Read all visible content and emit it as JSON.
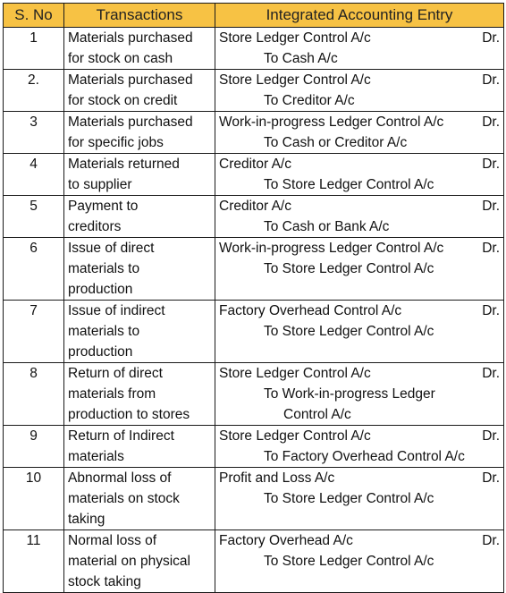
{
  "headers": {
    "sno": "S. No",
    "transactions": "Transactions",
    "entry": "Integrated Accounting Entry"
  },
  "rows": [
    {
      "sno": "1",
      "transaction": [
        "Materials purchased",
        "for stock on cash"
      ],
      "debit": "Store Ledger Control A/c",
      "dr": "Dr.",
      "credit": [
        "To Cash A/c"
      ]
    },
    {
      "sno": "2.",
      "transaction": [
        "Materials purchased",
        "for stock on credit"
      ],
      "debit": "Store Ledger Control A/c",
      "dr": "Dr.",
      "credit": [
        "To Creditor A/c"
      ]
    },
    {
      "sno": "3",
      "transaction": [
        "Materials purchased",
        "for specific jobs"
      ],
      "debit": "Work-in-progress Ledger Control A/c",
      "dr": "Dr.",
      "credit": [
        "To Cash or Creditor A/c"
      ]
    },
    {
      "sno": "4",
      "transaction": [
        "Materials returned",
        "to supplier"
      ],
      "debit": "Creditor A/c",
      "dr": "Dr.",
      "credit": [
        "To Store Ledger Control A/c"
      ]
    },
    {
      "sno": "5",
      "transaction": [
        "Payment to",
        "creditors"
      ],
      "debit": "Creditor A/c",
      "dr": "Dr.",
      "credit": [
        "To Cash or Bank A/c"
      ]
    },
    {
      "sno": "6",
      "transaction": [
        "Issue of direct",
        "materials to",
        "production"
      ],
      "debit": "Work-in-progress Ledger Control A/c",
      "dr": "Dr.",
      "credit": [
        "To Store Ledger Control A/c"
      ]
    },
    {
      "sno": "7",
      "transaction": [
        "Issue of indirect",
        "materials to",
        "production"
      ],
      "debit": "Factory Overhead Control A/c",
      "dr": "Dr.",
      "credit": [
        "To Store Ledger Control A/c"
      ]
    },
    {
      "sno": "8",
      "transaction": [
        "Return of direct",
        "materials from",
        "production to stores"
      ],
      "debit": "Store Ledger Control A/c",
      "dr": "Dr.",
      "credit": [
        "To Work-in-progress Ledger",
        "Control A/c"
      ]
    },
    {
      "sno": "9",
      "transaction": [
        "Return of Indirect",
        "materials"
      ],
      "debit": "Store Ledger Control A/c",
      "dr": "Dr.",
      "credit": [
        "To Factory Overhead Control A/c"
      ]
    },
    {
      "sno": "10",
      "transaction": [
        "Abnormal loss of",
        "materials on stock",
        "taking"
      ],
      "debit": "Profit and Loss A/c",
      "dr": "Dr.",
      "credit": [
        "To Store Ledger Control A/c"
      ]
    },
    {
      "sno": "11",
      "transaction": [
        "Normal loss of",
        "material on physical",
        "stock taking"
      ],
      "debit": "Factory Overhead A/c",
      "dr": "Dr.",
      "credit": [
        "To Store Ledger Control A/c"
      ]
    }
  ]
}
